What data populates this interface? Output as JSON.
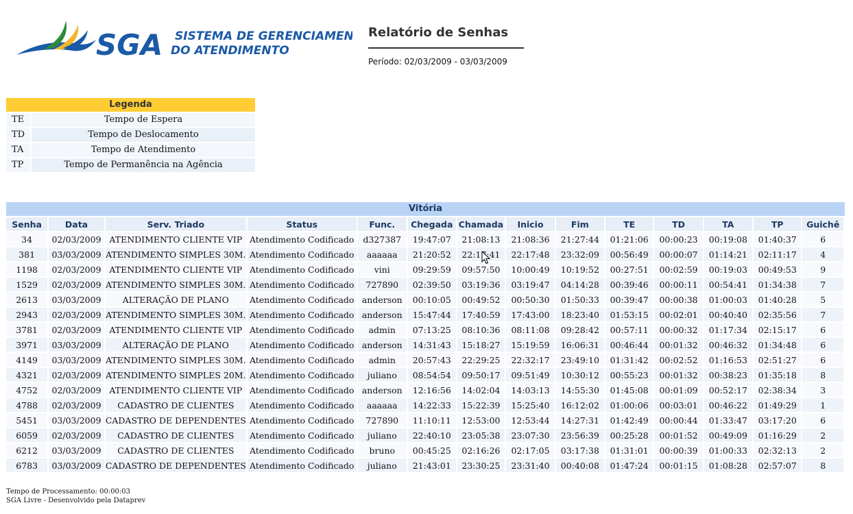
{
  "header": {
    "logo_text": "SGA",
    "logo_subtitle_line1": "SISTEMA DE GERENCIAMENTO",
    "logo_subtitle_line2": "DO ATENDIMENTO",
    "report_title": "Relatório de Senhas",
    "period": "Período: 02/03/2009 - 03/03/2009"
  },
  "legend": {
    "title": "Legenda",
    "items": [
      {
        "abbr": "TE",
        "desc": "Tempo de Espera"
      },
      {
        "abbr": "TD",
        "desc": "Tempo de Deslocamento"
      },
      {
        "abbr": "TA",
        "desc": "Tempo de Atendimento"
      },
      {
        "abbr": "TP",
        "desc": "Tempo de Permanência na Agência"
      }
    ]
  },
  "table": {
    "caption": "Vitória",
    "columns": [
      "Senha",
      "Data",
      "Serv. Triado",
      "Status",
      "Func.",
      "Chegada",
      "Chamada",
      "Inicio",
      "Fim",
      "TE",
      "TD",
      "TA",
      "TP",
      "Guichê"
    ],
    "rows": [
      [
        "34",
        "02/03/2009",
        "ATENDIMENTO CLIENTE VIP",
        "Atendimento Codificado",
        "d327387",
        "19:47:07",
        "21:08:13",
        "21:08:36",
        "21:27:44",
        "01:21:06",
        "00:00:23",
        "00:19:08",
        "01:40:37",
        "6"
      ],
      [
        "381",
        "03/03/2009",
        "ATENDIMENTO SIMPLES 30M.",
        "Atendimento Codificado",
        "aaaaaa",
        "21:20:52",
        "22:17:41",
        "22:17:48",
        "23:32:09",
        "00:56:49",
        "00:00:07",
        "01:14:21",
        "02:11:17",
        "4"
      ],
      [
        "1198",
        "02/03/2009",
        "ATENDIMENTO CLIENTE VIP",
        "Atendimento Codificado",
        "vini",
        "09:29:59",
        "09:57:50",
        "10:00:49",
        "10:19:52",
        "00:27:51",
        "00:02:59",
        "00:19:03",
        "00:49:53",
        "9"
      ],
      [
        "1529",
        "02/03/2009",
        "ATENDIMENTO SIMPLES 30M.",
        "Atendimento Codificado",
        "727890",
        "02:39:50",
        "03:19:36",
        "03:19:47",
        "04:14:28",
        "00:39:46",
        "00:00:11",
        "00:54:41",
        "01:34:38",
        "7"
      ],
      [
        "2613",
        "03/03/2009",
        "ALTERAÇÃO DE PLANO",
        "Atendimento Codificado",
        "anderson",
        "00:10:05",
        "00:49:52",
        "00:50:30",
        "01:50:33",
        "00:39:47",
        "00:00:38",
        "01:00:03",
        "01:40:28",
        "5"
      ],
      [
        "2943",
        "02/03/2009",
        "ATENDIMENTO SIMPLES 30M.",
        "Atendimento Codificado",
        "anderson",
        "15:47:44",
        "17:40:59",
        "17:43:00",
        "18:23:40",
        "01:53:15",
        "00:02:01",
        "00:40:40",
        "02:35:56",
        "7"
      ],
      [
        "3781",
        "02/03/2009",
        "ATENDIMENTO CLIENTE VIP",
        "Atendimento Codificado",
        "admin",
        "07:13:25",
        "08:10:36",
        "08:11:08",
        "09:28:42",
        "00:57:11",
        "00:00:32",
        "01:17:34",
        "02:15:17",
        "6"
      ],
      [
        "3971",
        "03/03/2009",
        "ALTERAÇÃO DE PLANO",
        "Atendimento Codificado",
        "anderson",
        "14:31:43",
        "15:18:27",
        "15:19:59",
        "16:06:31",
        "00:46:44",
        "00:01:32",
        "00:46:32",
        "01:34:48",
        "6"
      ],
      [
        "4149",
        "03/03/2009",
        "ATENDIMENTO SIMPLES 30M.",
        "Atendimento Codificado",
        "admin",
        "20:57:43",
        "22:29:25",
        "22:32:17",
        "23:49:10",
        "01:31:42",
        "00:02:52",
        "01:16:53",
        "02:51:27",
        "6"
      ],
      [
        "4321",
        "02/03/2009",
        "ATENDIMENTO SIMPLES 20M.",
        "Atendimento Codificado",
        "juliano",
        "08:54:54",
        "09:50:17",
        "09:51:49",
        "10:30:12",
        "00:55:23",
        "00:01:32",
        "00:38:23",
        "01:35:18",
        "8"
      ],
      [
        "4752",
        "02/03/2009",
        "ATENDIMENTO CLIENTE VIP",
        "Atendimento Codificado",
        "anderson",
        "12:16:56",
        "14:02:04",
        "14:03:13",
        "14:55:30",
        "01:45:08",
        "00:01:09",
        "00:52:17",
        "02:38:34",
        "3"
      ],
      [
        "4788",
        "02/03/2009",
        "CADASTRO DE CLIENTES",
        "Atendimento Codificado",
        "aaaaaa",
        "14:22:33",
        "15:22:39",
        "15:25:40",
        "16:12:02",
        "01:00:06",
        "00:03:01",
        "00:46:22",
        "01:49:29",
        "1"
      ],
      [
        "5451",
        "03/03/2009",
        "CADASTRO DE DEPENDENTES",
        "Atendimento Codificado",
        "727890",
        "11:10:11",
        "12:53:00",
        "12:53:44",
        "14:27:31",
        "01:42:49",
        "00:00:44",
        "01:33:47",
        "03:17:20",
        "6"
      ],
      [
        "6059",
        "02/03/2009",
        "CADASTRO DE CLIENTES",
        "Atendimento Codificado",
        "juliano",
        "22:40:10",
        "23:05:38",
        "23:07:30",
        "23:56:39",
        "00:25:28",
        "00:01:52",
        "00:49:09",
        "01:16:29",
        "2"
      ],
      [
        "6212",
        "03/03/2009",
        "CADASTRO DE CLIENTES",
        "Atendimento Codificado",
        "bruno",
        "00:45:25",
        "02:16:26",
        "02:17:05",
        "03:17:38",
        "01:31:01",
        "00:00:39",
        "01:00:33",
        "02:32:13",
        "2"
      ],
      [
        "6783",
        "03/03/2009",
        "CADASTRO DE DEPENDENTES",
        "Atendimento Codificado",
        "juliano",
        "21:43:01",
        "23:30:25",
        "23:31:40",
        "00:40:08",
        "01:47:24",
        "00:01:15",
        "01:08:28",
        "02:57:07",
        "8"
      ]
    ]
  },
  "footer": {
    "processing_time": "Tempo de Processamento: 00:00:03",
    "credits": "SGA Livre - Desenvolvido pela Dataprev"
  },
  "colors": {
    "legend_header": "#ffcc33",
    "table_caption": "#b9d3f5",
    "logo_blue": "#1b5aa6",
    "logo_green": "#2e8b3a",
    "logo_yellow": "#f2b52c"
  }
}
